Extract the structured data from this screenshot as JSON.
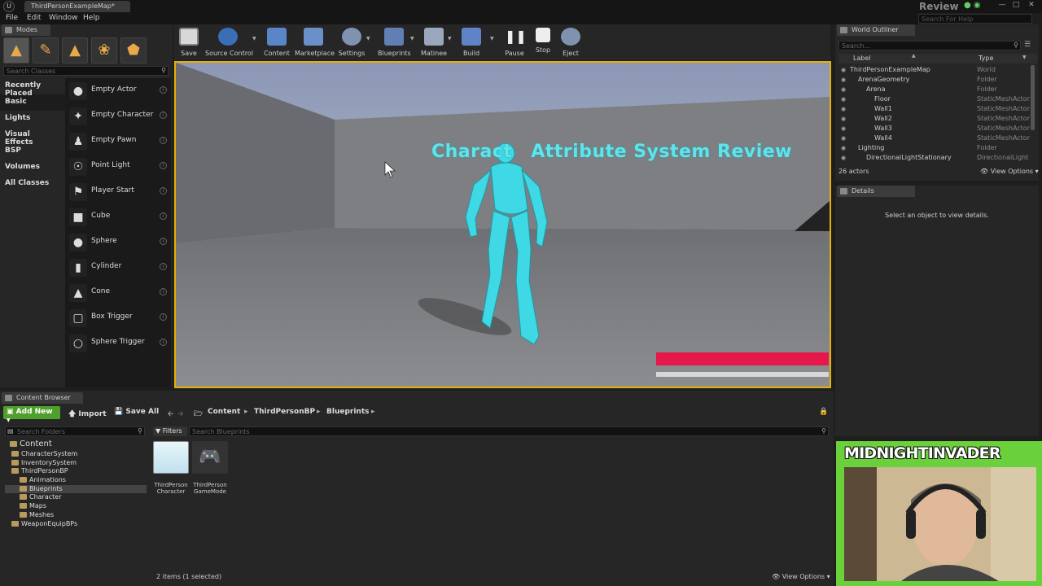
{
  "window": {
    "doc_tab": "ThirdPersonExampleMap*",
    "search_title": "Review",
    "help_search_placeholder": "Search For Help",
    "min_icon": "—",
    "max_icon": "□",
    "close_icon": "✕"
  },
  "menu": [
    "File",
    "Edit",
    "Window",
    "Help"
  ],
  "modes": {
    "tab_label": "Modes",
    "search_placeholder": "Search Classes",
    "categories": [
      "Recently Placed",
      "Basic",
      "Lights",
      "Visual Effects",
      "BSP",
      "Volumes",
      "All Classes"
    ],
    "active_category": "Basic",
    "actors": [
      {
        "label": "Empty Actor",
        "icon": "sphere-icon"
      },
      {
        "label": "Empty Character",
        "icon": "character-icon"
      },
      {
        "label": "Empty Pawn",
        "icon": "pawn-icon"
      },
      {
        "label": "Point Light",
        "icon": "lightbulb-icon"
      },
      {
        "label": "Player Start",
        "icon": "player-start-icon"
      },
      {
        "label": "Cube",
        "icon": "cube-icon"
      },
      {
        "label": "Sphere",
        "icon": "sphere-icon"
      },
      {
        "label": "Cylinder",
        "icon": "cylinder-icon"
      },
      {
        "label": "Cone",
        "icon": "cone-icon"
      },
      {
        "label": "Box Trigger",
        "icon": "box-trigger-icon"
      },
      {
        "label": "Sphere Trigger",
        "icon": "sphere-trigger-icon"
      }
    ]
  },
  "toolbar": {
    "buttons": [
      {
        "label": "Save",
        "icon": "save-icon"
      },
      {
        "label": "Source Control",
        "icon": "source-control-icon"
      },
      {
        "label": "Content",
        "icon": "content-icon"
      },
      {
        "label": "Marketplace",
        "icon": "marketplace-icon"
      },
      {
        "label": "Settings",
        "icon": "settings-icon"
      },
      {
        "label": "Blueprints",
        "icon": "blueprints-icon"
      },
      {
        "label": "Matinee",
        "icon": "matinee-icon"
      },
      {
        "label": "Build",
        "icon": "build-icon"
      },
      {
        "label": "Pause",
        "icon": "pause-icon"
      },
      {
        "label": "Stop",
        "icon": "stop-icon"
      },
      {
        "label": "Eject",
        "icon": "eject-icon"
      }
    ]
  },
  "viewport": {
    "title_text": "Charact    Attribute System Review",
    "health_fraction": 1.0,
    "stamina_fraction": 1.0,
    "colors": {
      "character": "#3fd9e6",
      "health": "#e6174a",
      "stamina": "#d8d8d8",
      "border": "#e6b000"
    }
  },
  "outliner": {
    "tab_label": "World Outliner",
    "search_placeholder": "Search...",
    "col_label": "Label",
    "col_type": "Type",
    "rows": [
      {
        "label": "ThirdPersonExampleMap",
        "type": "World",
        "depth": 0
      },
      {
        "label": "ArenaGeometry",
        "type": "Folder",
        "depth": 1
      },
      {
        "label": "Arena",
        "type": "Folder",
        "depth": 2
      },
      {
        "label": "Floor",
        "type": "StaticMeshActor",
        "depth": 3
      },
      {
        "label": "Wall1",
        "type": "StaticMeshActor",
        "depth": 3
      },
      {
        "label": "Wall2",
        "type": "StaticMeshActor",
        "depth": 3
      },
      {
        "label": "Wall3",
        "type": "StaticMeshActor",
        "depth": 3
      },
      {
        "label": "Wall4",
        "type": "StaticMeshActor",
        "depth": 3
      },
      {
        "label": "Lighting",
        "type": "Folder",
        "depth": 1
      },
      {
        "label": "DirectionalLightStationary",
        "type": "DirectionalLight",
        "depth": 2
      }
    ],
    "actor_count": "26 actors",
    "view_options": "View Options"
  },
  "details": {
    "tab_label": "Details",
    "empty_text": "Select an object to view details."
  },
  "content_browser": {
    "tab_label": "Content Browser",
    "add_new": "Add New",
    "import": "Import",
    "save_all": "Save All",
    "breadcrumbs": [
      "Content",
      "ThirdPersonBP",
      "Blueprints"
    ],
    "folder_search_placeholder": "Search Folders",
    "filters": "Filters",
    "asset_search_placeholder": "Search Blueprints",
    "tree": [
      {
        "label": "Content",
        "depth": 0
      },
      {
        "label": "CharacterSystem",
        "depth": 1
      },
      {
        "label": "InventorySystem",
        "depth": 1
      },
      {
        "label": "ThirdPersonBP",
        "depth": 1
      },
      {
        "label": "Animations",
        "depth": 2
      },
      {
        "label": "Blueprints",
        "depth": 2
      },
      {
        "label": "Character",
        "depth": 2
      },
      {
        "label": "Maps",
        "depth": 2
      },
      {
        "label": "Meshes",
        "depth": 2
      },
      {
        "label": "WeaponEquipBPs",
        "depth": 1
      }
    ],
    "selected_folder": "Blueprints",
    "assets": [
      {
        "name_line1": "ThirdPerson",
        "name_line2": "Character",
        "icon": "character-blueprint-icon"
      },
      {
        "name_line1": "ThirdPerson",
        "name_line2": "GameMode",
        "icon": "gamepad-icon"
      }
    ],
    "status": "2 items (1 selected)",
    "view_options": "View Options"
  },
  "webcam": {
    "streamer_name": "MIDNIGHTINVADER",
    "frame_color": "#6ad13a"
  }
}
